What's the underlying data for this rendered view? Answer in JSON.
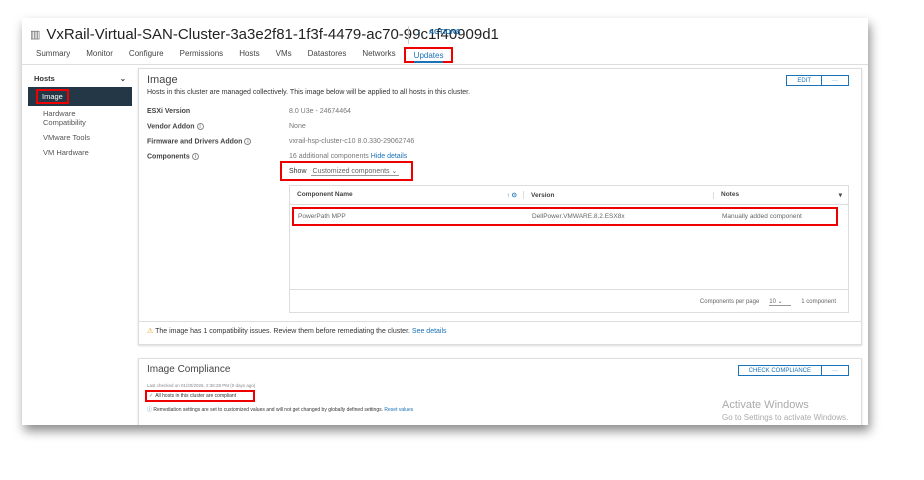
{
  "header": {
    "title": "VxRail-Virtual-SAN-Cluster-3a3e2f81-1f3f-4479-ac70-99c1f40909d1",
    "actions": "ACTIONS"
  },
  "tabs": [
    "Summary",
    "Monitor",
    "Configure",
    "Permissions",
    "Hosts",
    "VMs",
    "Datastores",
    "Networks",
    "Updates"
  ],
  "sidebar": {
    "group": "Hosts",
    "items": [
      "Image",
      "Hardware Compatibility",
      "VMware Tools",
      "VM Hardware"
    ]
  },
  "image": {
    "title": "Image",
    "description": "Hosts in this cluster are managed collectively. This image below will be applied to all hosts in this cluster.",
    "edit": "EDIT",
    "more": "···",
    "fields": [
      {
        "label": "ESXi Version",
        "value": "8.0 U3e - 24674464"
      },
      {
        "label": "Vendor Addon",
        "value": "None"
      },
      {
        "label": "Firmware and Drivers Addon",
        "value": "vxrail-hsp-cluster-c10 8.0.330-29062746"
      },
      {
        "label": "Components",
        "value": "16 additional components"
      }
    ],
    "hide_details": "Hide details",
    "show_label": "Show",
    "show_value": "Customized components",
    "columns": [
      "Component Name",
      "Version",
      "Notes"
    ],
    "rows": [
      {
        "name": "PowerPath MPP",
        "version": "DellPower.VMWARE.8.2.ESX8x",
        "notes": "Manually added component"
      }
    ],
    "per_page_label": "Components per page",
    "per_page": "10",
    "count": "1 component",
    "warning": "The image has 1 compatibility issues. Review them before remediating the cluster.",
    "see_details": "See details"
  },
  "compliance": {
    "title": "Image Compliance",
    "check": "CHECK COMPLIANCE",
    "more": "···",
    "last_checked": "Last checked on 01/20/2026, 2:36:28 PM (0 days ago)",
    "status": "All hosts in this cluster are compliant",
    "remediation": "Remediation settings are set to customized values and will not get changed by globally defined settings.",
    "reset": "Reset values"
  },
  "watermark": {
    "line1": "Activate Windows",
    "line2": "Go to Settings to activate Windows."
  }
}
